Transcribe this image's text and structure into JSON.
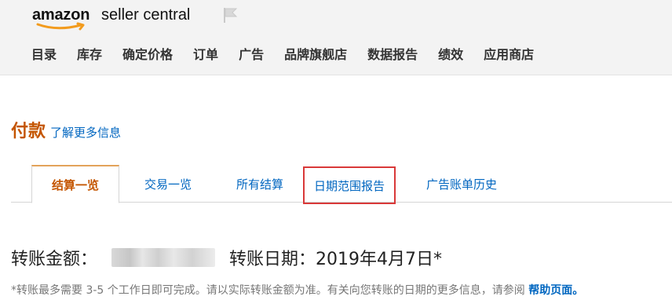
{
  "header": {
    "logo": {
      "brand": "amazon",
      "suffix": "seller central"
    },
    "icons": {
      "logo_smile": "amazon-smile-icon",
      "flag": "flag-icon"
    },
    "nav": {
      "items": [
        {
          "label": "目录"
        },
        {
          "label": "库存"
        },
        {
          "label": "确定价格"
        },
        {
          "label": "订单"
        },
        {
          "label": "广告"
        },
        {
          "label": "品牌旗舰店"
        },
        {
          "label": "数据报告"
        },
        {
          "label": "绩效"
        },
        {
          "label": "应用商店"
        }
      ]
    }
  },
  "page": {
    "title": "付款",
    "learn_more": "了解更多信息"
  },
  "tabs": {
    "items": [
      {
        "label": "结算一览",
        "state": "active"
      },
      {
        "label": "交易一览",
        "state": "normal"
      },
      {
        "label": "所有结算",
        "state": "normal"
      },
      {
        "label": "日期范围报告",
        "state": "highlighted"
      },
      {
        "label": "广告账单历史",
        "state": "normal"
      }
    ]
  },
  "transfer": {
    "amount_label": "转账金额：",
    "date_label": "转账日期：",
    "date_value": "2019年4月7日*"
  },
  "footnote": {
    "text": "*转账最多需要 3-5 个工作日即可完成。请以实际转账金额为准。有关向您转账的日期的更多信息，请参阅",
    "link": "帮助页面。"
  },
  "colors": {
    "header_bg": "#f3f3f3",
    "title_orange": "#c45500",
    "link_blue": "#0066c0",
    "active_tab_top": "#e3a35a",
    "highlight_red": "#d93939",
    "blur_gray": "#d4d4d4"
  }
}
